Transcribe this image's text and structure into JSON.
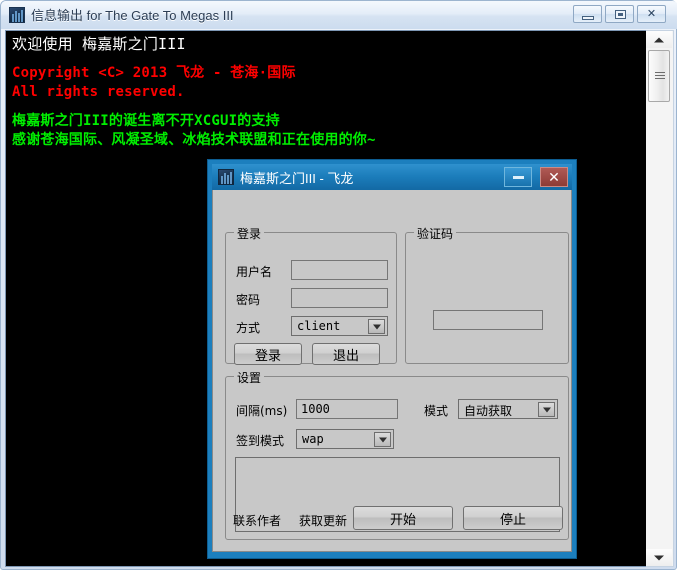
{
  "window": {
    "title": "信息输出 for The Gate To Megas III",
    "icon": "app-tower-icon",
    "controls": {
      "minimize": "minimize-icon",
      "maximize": "maximize-icon",
      "close": "✕"
    }
  },
  "console": {
    "lines": [
      {
        "text": "欢迎使用 梅嘉斯之门III",
        "color": "white"
      },
      {
        "text": "",
        "color": "white"
      },
      {
        "text": "Copyright <C> 2013 飞龙 - 苍海·国际",
        "color": "red"
      },
      {
        "text": "All rights reserved.",
        "color": "red"
      },
      {
        "text": "",
        "color": "white"
      },
      {
        "text": "梅嘉斯之门III的诞生离不开XCGUI的支持",
        "color": "green"
      },
      {
        "text": "感谢苍海国际、风凝圣域、冰焰技术联盟和正在使用的你~",
        "color": "green"
      }
    ],
    "colors": {
      "white": "#ffffff",
      "red": "#ff0000",
      "green": "#00ee00",
      "background": "#000000"
    }
  },
  "scrollbar": {
    "up_arrow": "scroll-up-icon",
    "down_arrow": "scroll-down-icon",
    "thumb": "scroll-thumb"
  },
  "dialog": {
    "title": "梅嘉斯之门III - 飞龙",
    "icon": "app-tower-icon",
    "minimize_label": "minimize-icon",
    "close_label": "✕",
    "login_group": {
      "title": "登录",
      "username_label": "用户名",
      "username_value": "",
      "password_label": "密码",
      "password_value": "",
      "method_label": "方式",
      "method_value": "client",
      "login_button": "登录",
      "exit_button": "退出"
    },
    "captcha_group": {
      "title": "验证码",
      "input_value": ""
    },
    "settings_group": {
      "title": "设置",
      "interval_label": "间隔(ms)",
      "interval_value": "1000",
      "mode_label": "模式",
      "mode_value": "自动获取",
      "checkin_label": "签到模式",
      "checkin_value": "wap",
      "log_value": "",
      "contact_link": "联系作者",
      "update_link": "获取更新",
      "start_button": "开始",
      "stop_button": "停止"
    }
  }
}
